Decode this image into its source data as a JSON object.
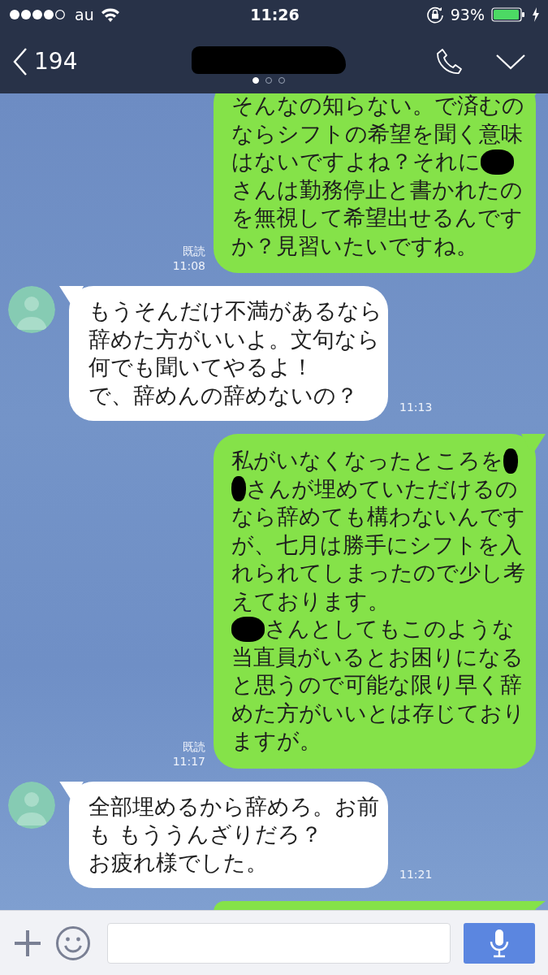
{
  "status_bar": {
    "carrier": "au",
    "time": "11:26",
    "battery": "93%"
  },
  "header": {
    "back_count": "194",
    "title_redacted": true,
    "page_dots": [
      {
        "selected": true
      },
      {
        "selected": false
      },
      {
        "selected": false
      }
    ]
  },
  "messages": [
    {
      "kind": "sent",
      "read": "既読",
      "time": "11:08",
      "lines": [
        [
          "そんなの知らない。で済むの"
        ],
        [
          "ならシフトの希望を聞く意味"
        ],
        [
          "はないですよね？それに",
          {
            "kind": "redaction"
          }
        ],
        [
          "さんは勤務停止と書かれたの"
        ],
        [
          "を無視して希望出せるんです"
        ],
        [
          "か？見習いたいですね。"
        ]
      ]
    },
    {
      "kind": "received",
      "time": "11:13",
      "lines": [
        [
          "もうそんだけ不満があるなら"
        ],
        [
          "辞めた方がいいよ。文句なら"
        ],
        [
          "何でも聞いてやるよ！"
        ],
        [
          "で、辞めんの辞めないの？"
        ]
      ]
    },
    {
      "kind": "sent",
      "read": "既読",
      "time": "11:17",
      "lines": [
        [
          "私がいなくなったところを",
          {
            "kind": "redaction"
          }
        ],
        [
          {
            "kind": "redaction"
          },
          "さんが埋めていただけるの"
        ],
        [
          "なら辞めても構わないんです"
        ],
        [
          "が、七月は勝手にシフトを入"
        ],
        [
          "れられてしまったので少し考"
        ],
        [
          "えております。"
        ],
        [
          {
            "kind": "redaction"
          },
          "さんとしてもこのような"
        ],
        [
          "当直員がいるとお困りになる"
        ],
        [
          "と思うので可能な限り早く辞"
        ],
        [
          "めた方がいいとは存じており"
        ],
        [
          "ますが。"
        ]
      ]
    },
    {
      "kind": "received",
      "time": "11:21",
      "lines": [
        [
          "全部埋めるから辞めろ。お前"
        ],
        [
          "も もううんざりだろ？"
        ],
        [
          "お疲れ様でした。"
        ]
      ]
    },
    {
      "kind": "sent"
    }
  ]
}
